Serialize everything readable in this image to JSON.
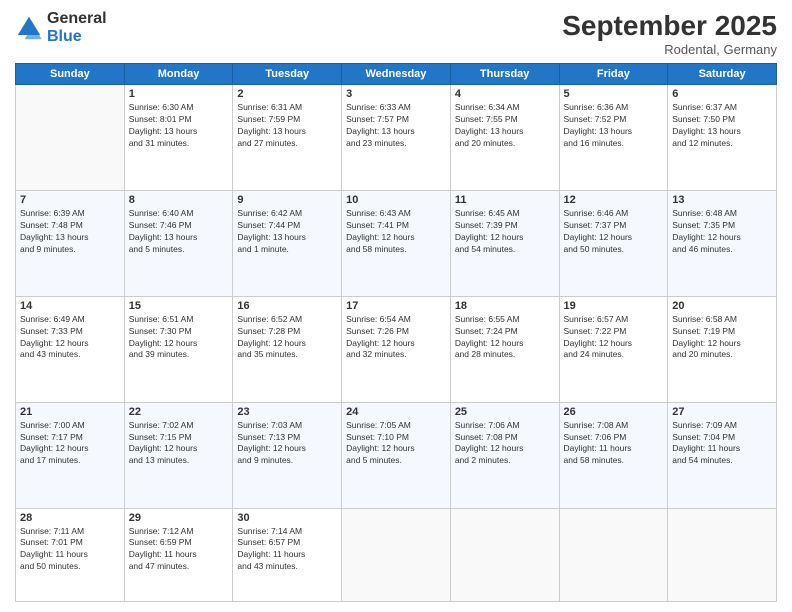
{
  "header": {
    "logo_general": "General",
    "logo_blue": "Blue",
    "month": "September 2025",
    "location": "Rodental, Germany"
  },
  "days_of_week": [
    "Sunday",
    "Monday",
    "Tuesday",
    "Wednesday",
    "Thursday",
    "Friday",
    "Saturday"
  ],
  "weeks": [
    [
      {
        "day": "",
        "info": ""
      },
      {
        "day": "1",
        "info": "Sunrise: 6:30 AM\nSunset: 8:01 PM\nDaylight: 13 hours\nand 31 minutes."
      },
      {
        "day": "2",
        "info": "Sunrise: 6:31 AM\nSunset: 7:59 PM\nDaylight: 13 hours\nand 27 minutes."
      },
      {
        "day": "3",
        "info": "Sunrise: 6:33 AM\nSunset: 7:57 PM\nDaylight: 13 hours\nand 23 minutes."
      },
      {
        "day": "4",
        "info": "Sunrise: 6:34 AM\nSunset: 7:55 PM\nDaylight: 13 hours\nand 20 minutes."
      },
      {
        "day": "5",
        "info": "Sunrise: 6:36 AM\nSunset: 7:52 PM\nDaylight: 13 hours\nand 16 minutes."
      },
      {
        "day": "6",
        "info": "Sunrise: 6:37 AM\nSunset: 7:50 PM\nDaylight: 13 hours\nand 12 minutes."
      }
    ],
    [
      {
        "day": "7",
        "info": "Sunrise: 6:39 AM\nSunset: 7:48 PM\nDaylight: 13 hours\nand 9 minutes."
      },
      {
        "day": "8",
        "info": "Sunrise: 6:40 AM\nSunset: 7:46 PM\nDaylight: 13 hours\nand 5 minutes."
      },
      {
        "day": "9",
        "info": "Sunrise: 6:42 AM\nSunset: 7:44 PM\nDaylight: 13 hours\nand 1 minute."
      },
      {
        "day": "10",
        "info": "Sunrise: 6:43 AM\nSunset: 7:41 PM\nDaylight: 12 hours\nand 58 minutes."
      },
      {
        "day": "11",
        "info": "Sunrise: 6:45 AM\nSunset: 7:39 PM\nDaylight: 12 hours\nand 54 minutes."
      },
      {
        "day": "12",
        "info": "Sunrise: 6:46 AM\nSunset: 7:37 PM\nDaylight: 12 hours\nand 50 minutes."
      },
      {
        "day": "13",
        "info": "Sunrise: 6:48 AM\nSunset: 7:35 PM\nDaylight: 12 hours\nand 46 minutes."
      }
    ],
    [
      {
        "day": "14",
        "info": "Sunrise: 6:49 AM\nSunset: 7:33 PM\nDaylight: 12 hours\nand 43 minutes."
      },
      {
        "day": "15",
        "info": "Sunrise: 6:51 AM\nSunset: 7:30 PM\nDaylight: 12 hours\nand 39 minutes."
      },
      {
        "day": "16",
        "info": "Sunrise: 6:52 AM\nSunset: 7:28 PM\nDaylight: 12 hours\nand 35 minutes."
      },
      {
        "day": "17",
        "info": "Sunrise: 6:54 AM\nSunset: 7:26 PM\nDaylight: 12 hours\nand 32 minutes."
      },
      {
        "day": "18",
        "info": "Sunrise: 6:55 AM\nSunset: 7:24 PM\nDaylight: 12 hours\nand 28 minutes."
      },
      {
        "day": "19",
        "info": "Sunrise: 6:57 AM\nSunset: 7:22 PM\nDaylight: 12 hours\nand 24 minutes."
      },
      {
        "day": "20",
        "info": "Sunrise: 6:58 AM\nSunset: 7:19 PM\nDaylight: 12 hours\nand 20 minutes."
      }
    ],
    [
      {
        "day": "21",
        "info": "Sunrise: 7:00 AM\nSunset: 7:17 PM\nDaylight: 12 hours\nand 17 minutes."
      },
      {
        "day": "22",
        "info": "Sunrise: 7:02 AM\nSunset: 7:15 PM\nDaylight: 12 hours\nand 13 minutes."
      },
      {
        "day": "23",
        "info": "Sunrise: 7:03 AM\nSunset: 7:13 PM\nDaylight: 12 hours\nand 9 minutes."
      },
      {
        "day": "24",
        "info": "Sunrise: 7:05 AM\nSunset: 7:10 PM\nDaylight: 12 hours\nand 5 minutes."
      },
      {
        "day": "25",
        "info": "Sunrise: 7:06 AM\nSunset: 7:08 PM\nDaylight: 12 hours\nand 2 minutes."
      },
      {
        "day": "26",
        "info": "Sunrise: 7:08 AM\nSunset: 7:06 PM\nDaylight: 11 hours\nand 58 minutes."
      },
      {
        "day": "27",
        "info": "Sunrise: 7:09 AM\nSunset: 7:04 PM\nDaylight: 11 hours\nand 54 minutes."
      }
    ],
    [
      {
        "day": "28",
        "info": "Sunrise: 7:11 AM\nSunset: 7:01 PM\nDaylight: 11 hours\nand 50 minutes."
      },
      {
        "day": "29",
        "info": "Sunrise: 7:12 AM\nSunset: 6:59 PM\nDaylight: 11 hours\nand 47 minutes."
      },
      {
        "day": "30",
        "info": "Sunrise: 7:14 AM\nSunset: 6:57 PM\nDaylight: 11 hours\nand 43 minutes."
      },
      {
        "day": "",
        "info": ""
      },
      {
        "day": "",
        "info": ""
      },
      {
        "day": "",
        "info": ""
      },
      {
        "day": "",
        "info": ""
      }
    ]
  ]
}
